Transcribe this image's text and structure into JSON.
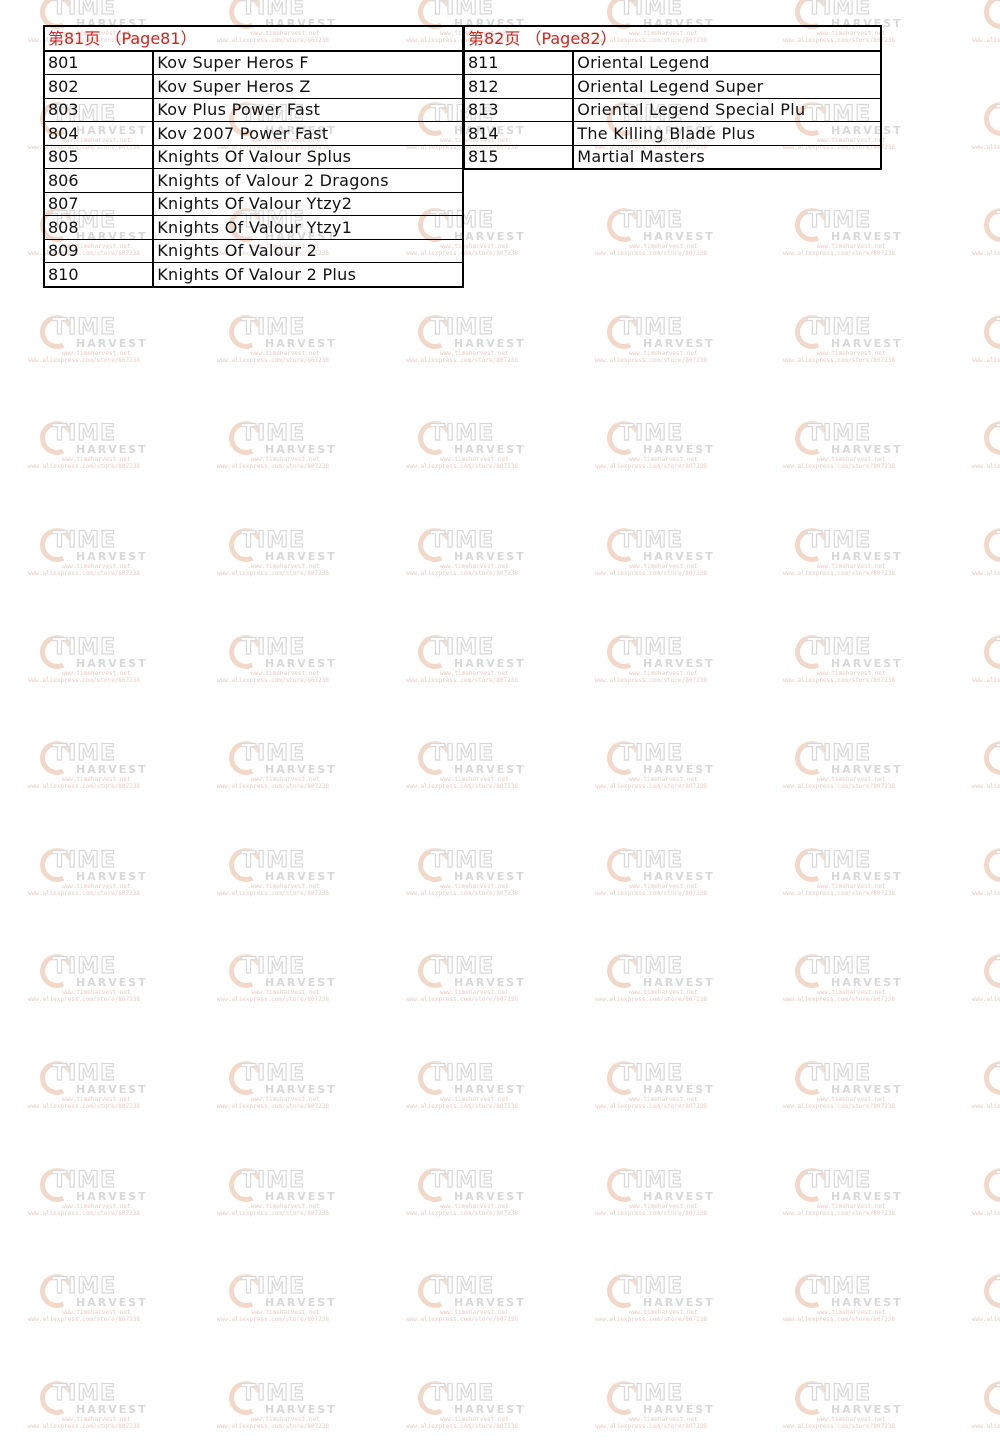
{
  "watermark": {
    "brand_top": "TIME",
    "brand_bottom": "HARVEST",
    "url1": "www.timeharvest.net",
    "url2": "www.aliexpress.com/store/807238"
  },
  "tables": [
    {
      "header": "第81页 （Page81）",
      "rows": [
        {
          "num": "801",
          "name": "Kov Super Heros F"
        },
        {
          "num": "802",
          "name": "Kov Super Heros Z"
        },
        {
          "num": "803",
          "name": "Kov Plus Power Fast"
        },
        {
          "num": "804",
          "name": "Kov 2007 Power Fast"
        },
        {
          "num": "805",
          "name": "Knights Of Valour Splus"
        },
        {
          "num": "806",
          "name": "Knights of Valour 2 Dragons"
        },
        {
          "num": "807",
          "name": "Knights Of Valour Ytzy2"
        },
        {
          "num": "808",
          "name": "Knights Of Valour Ytzy1"
        },
        {
          "num": "809",
          "name": "Knights Of Valour 2"
        },
        {
          "num": "810",
          "name": "Knights Of Valour 2 Plus"
        }
      ]
    },
    {
      "header": "第82页 （Page82）",
      "rows": [
        {
          "num": "811",
          "name": "Oriental Legend"
        },
        {
          "num": "812",
          "name": "Oriental Legend Super"
        },
        {
          "num": "813",
          "name": "Oriental Legend Special Plu"
        },
        {
          "num": "814",
          "name": "The Killing Blade Plus"
        },
        {
          "num": "815",
          "name": "Martial Masters"
        }
      ]
    }
  ],
  "colors": {
    "header_text": "#d2231e",
    "border": "#000000"
  }
}
